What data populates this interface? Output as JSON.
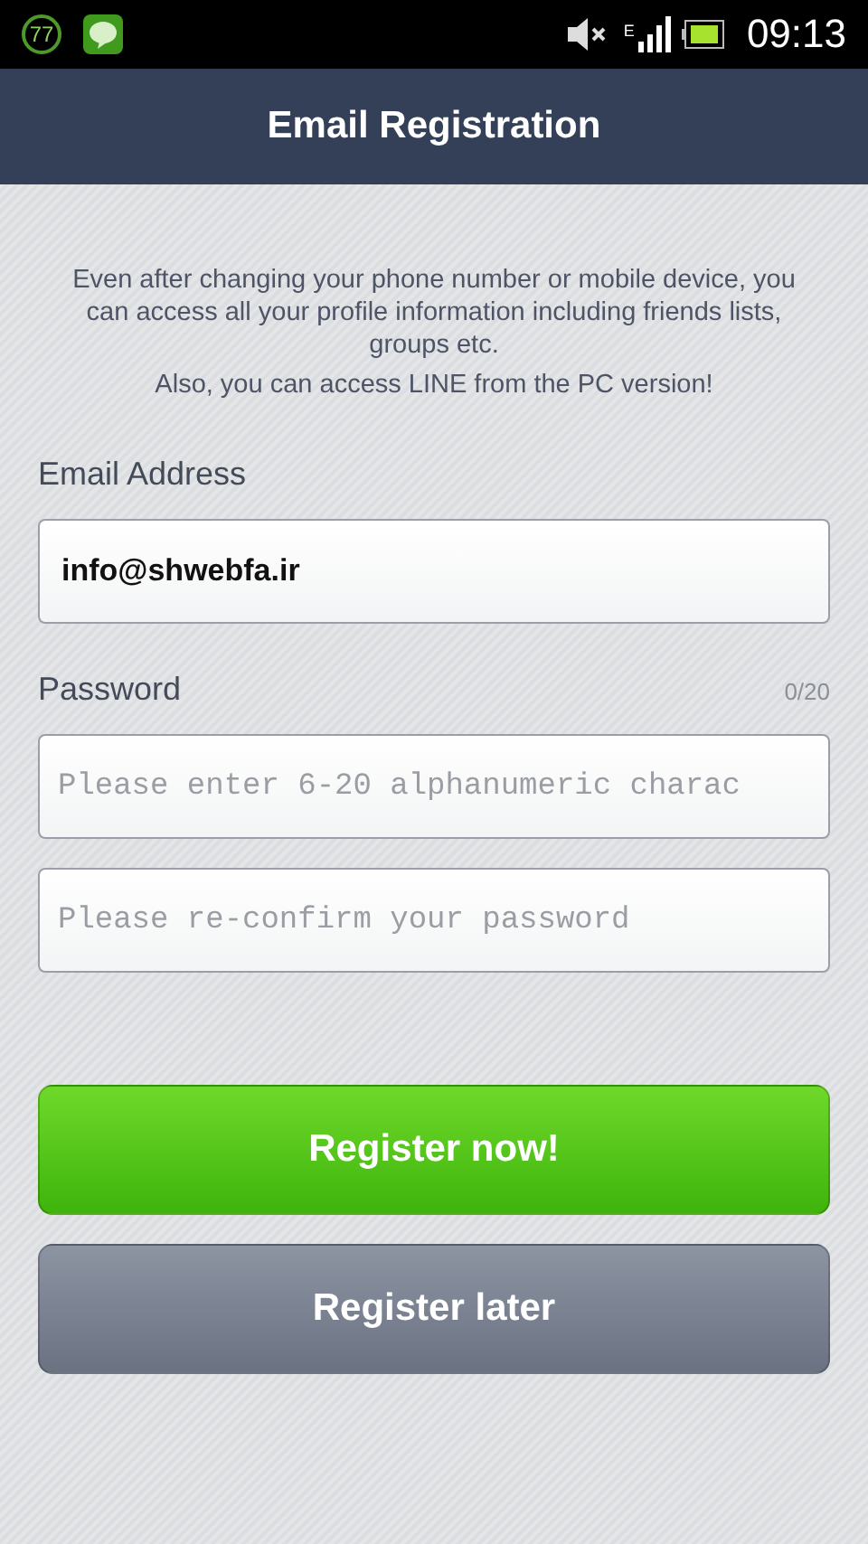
{
  "status_bar": {
    "notification_count": "77",
    "network_type": "E",
    "time": "09:13"
  },
  "header": {
    "title": "Email Registration"
  },
  "intro": [
    "Even after changing your phone number or mobile device, you can access all your profile information including friends lists, groups etc.",
    "Also, you can access LINE from the PC version!"
  ],
  "email": {
    "label": "Email Address",
    "value": "info@shwebfa.ir"
  },
  "password": {
    "label": "Password",
    "counter": "0/20",
    "placeholder": "Please enter 6-20 alphanumeric charac",
    "confirm_placeholder": "Please re-confirm your password"
  },
  "buttons": [
    {
      "label": "Register now!",
      "kind": "primary"
    },
    {
      "label": "Register later",
      "kind": "secondary"
    }
  ]
}
